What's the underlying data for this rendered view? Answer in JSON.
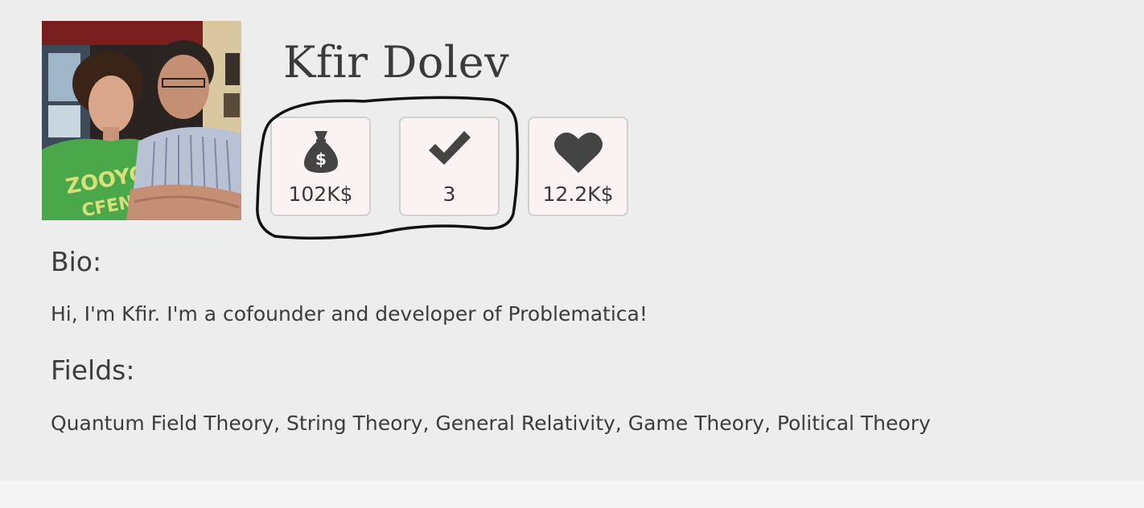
{
  "profile": {
    "name": "Kfir Dolev",
    "avatar_alt_icon": "profile-photo"
  },
  "stats": [
    {
      "icon": "money-bag-icon",
      "value": "102K$"
    },
    {
      "icon": "checkmark-icon",
      "value": "3"
    },
    {
      "icon": "heart-icon",
      "value": "12.2K$"
    }
  ],
  "bio": {
    "heading": "Bio:",
    "text": "Hi, I'm Kfir. I'm a cofounder and developer of Problematica!"
  },
  "fields": {
    "heading": "Fields:",
    "text": "Quantum Field Theory, String Theory, General Relativity, Game Theory, Political Theory"
  },
  "colors": {
    "background": "#ededed",
    "card_background": "#fbf3f3",
    "icon": "#444444",
    "annotation": "#111111"
  }
}
